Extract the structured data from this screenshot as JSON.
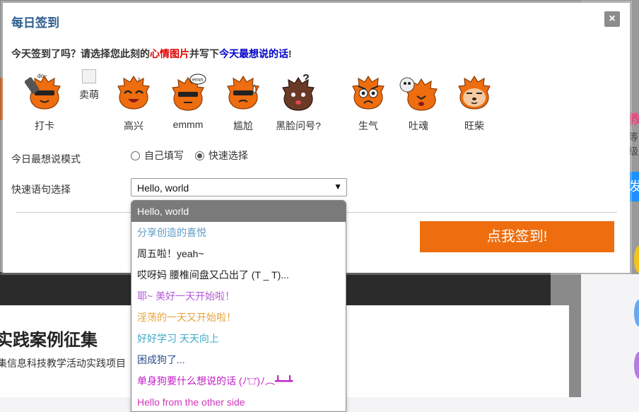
{
  "background": {
    "section_title": "实践案例征集",
    "section_desc": "集信息科技教学活动实践项目",
    "side_text_pink": "教",
    "side_text_gray": "等级",
    "side_tab": "发"
  },
  "modal": {
    "title": "每日签到",
    "close_label": "×",
    "prompt": {
      "part1": "今天签到了吗？请选择您此刻的",
      "red": "心情图片",
      "part2": "并写下",
      "blue": "今天最想说的话",
      "part3": "!"
    },
    "moods": [
      {
        "label": "打卡",
        "icon": "punch-in-icon"
      },
      {
        "label": "卖萌",
        "icon": "broken-image-icon"
      },
      {
        "label": "高兴",
        "icon": "happy-icon"
      },
      {
        "label": "emmm",
        "icon": "emmm-icon"
      },
      {
        "label": "尴尬",
        "icon": "awkward-icon"
      },
      {
        "label": "黑脸问号?",
        "icon": "black-face-question-icon"
      },
      {
        "label": "生气",
        "icon": "angry-icon"
      },
      {
        "label": "吐魂",
        "icon": "soul-out-icon"
      },
      {
        "label": "旺柴",
        "icon": "doge-icon"
      }
    ],
    "mode_label": "今日最想说模式",
    "mode_options": [
      "自己填写",
      "快速选择"
    ],
    "mode_selected": "快速选择",
    "quick_label": "快速语句选择",
    "quick_value": "Hello, world",
    "quick_options": [
      {
        "text": "Hello, world",
        "color": "#ffffff"
      },
      {
        "text": "分享创造的喜悦",
        "color": "#5b9bc9"
      },
      {
        "text": "周五啦！yeah~",
        "color": "#222222"
      },
      {
        "text": "哎呀妈 腰椎间盘又凸出了 (T _ T)...",
        "color": "#222222"
      },
      {
        "text": "耶~ 美好一天开始啦！",
        "color": "#b45ad6"
      },
      {
        "text": "淫荡的一天又开始啦！",
        "color": "#e8a33c"
      },
      {
        "text": "好好学习 天天向上",
        "color": "#3da8c8"
      },
      {
        "text": "困成狗了...",
        "color": "#2a4f8a"
      },
      {
        "text": "单身狗要什么想说的话 (ﾉ'□')ﾉ︵┻━┻",
        "color": "#c020c8"
      },
      {
        "text": "Hello from the other side",
        "color": "#d036b8"
      }
    ],
    "submit_label": "点我签到!"
  },
  "colors": {
    "accent": "#ee6d0e",
    "title": "#2c5d8f",
    "mascot_orange": "#ee6d0e",
    "mascot_brown": "#6b3a26"
  }
}
